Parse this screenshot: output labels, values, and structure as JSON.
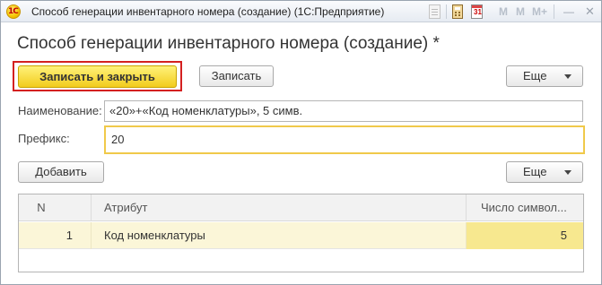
{
  "window": {
    "title": "Способ генерации инвентарного номера (создание)  (1С:Предприятие)",
    "app_logo_text": "1С",
    "toolbar_icons": [
      "page-icon",
      "calculator-icon",
      "calendar-icon"
    ],
    "calendar_day": "31",
    "memory_buttons": [
      "M",
      "M",
      "M+"
    ],
    "minimize_label": "—",
    "close_label": "✕"
  },
  "form": {
    "title": "Способ генерации инвентарного номера (создание) *"
  },
  "command_bar": {
    "save_close_label": "Записать и закрыть",
    "save_label": "Записать",
    "more_label": "Еще"
  },
  "fields": {
    "name_label": "Наименование:",
    "name_value": "«20»+«Код номенклатуры», 5 симв.",
    "prefix_label": "Префикс:",
    "prefix_value": "20"
  },
  "table_commands": {
    "add_label": "Добавить",
    "more_label": "Еще"
  },
  "table": {
    "columns": [
      "N",
      "Атрибут",
      "Число символ..."
    ],
    "rows": [
      {
        "n": "1",
        "attribute": "Код номенклатуры",
        "count": "5"
      }
    ]
  },
  "colors": {
    "primary_button": "#f2cc1d",
    "highlight_frame": "#d42020",
    "selected_row": "#fbf6d8",
    "focused_field_border": "#f0c94a"
  }
}
